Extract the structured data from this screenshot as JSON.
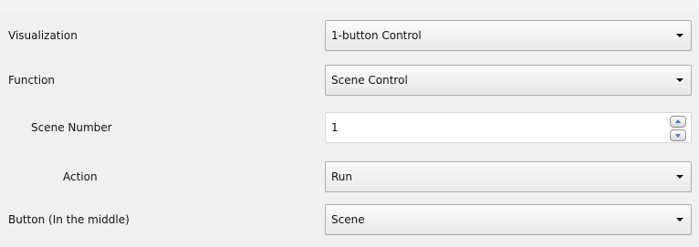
{
  "rows": [
    {
      "label": "Visualization",
      "value": "1-button Control",
      "icon": "chevron-down-icon"
    },
    {
      "label": "Function",
      "value": "Scene Control",
      "icon": "chevron-down-icon"
    },
    {
      "label": "Scene Number",
      "value": "1",
      "icons": [
        "spin-up-icon",
        "spin-down-icon"
      ]
    },
    {
      "label": "Action",
      "value": "Run",
      "icon": "chevron-down-icon"
    },
    {
      "label": "Button (In the middle)",
      "value": "Scene",
      "icon": "chevron-down-icon"
    }
  ]
}
